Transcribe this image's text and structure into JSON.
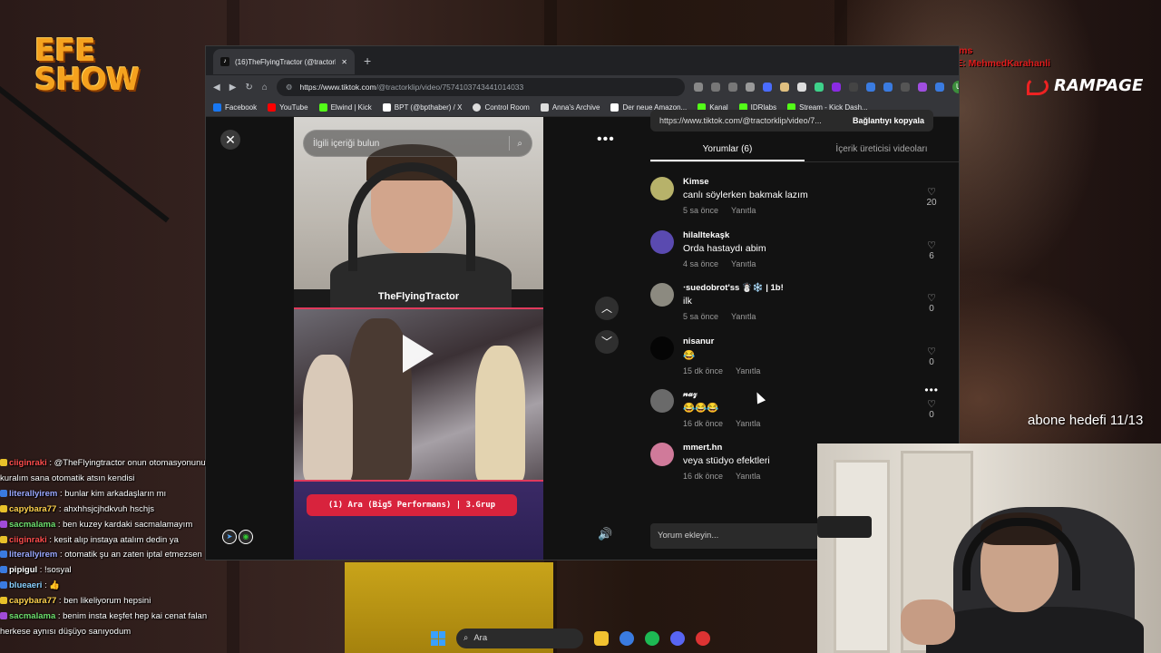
{
  "overlay": {
    "logo_top": "EFE",
    "logo_bottom": "SHOW",
    "sponsor": "RAMPAGE",
    "last_sub_label": "SON ABONE: remynms",
    "last_gift_label": "SON ABONE HEDİYE: MehmedKarahanli",
    "sub_goal": "abone hedefi 11/13"
  },
  "browser": {
    "tab_title": "(16)TheFlyingTractor (@tractorkl",
    "url_host": "https://www.tiktok.com",
    "url_path": "/@tractorklip/video/7574103743441014033",
    "bookmarks": [
      {
        "label": "Facebook",
        "color": "#1877f2"
      },
      {
        "label": "YouTube",
        "color": "#ff0000"
      },
      {
        "label": "Elwind | Kick",
        "color": "#53fc18"
      },
      {
        "label": "BPT (@bpthaber) / X",
        "color": "#ffffff"
      },
      {
        "label": "Control Room",
        "color": "#dddddd"
      },
      {
        "label": "Anna's Archive",
        "color": "#dddddd"
      },
      {
        "label": "Der neue Amazon...",
        "color": "#ffffff"
      },
      {
        "label": "Kanal",
        "color": "#53fc18"
      },
      {
        "label": "IDRlabs",
        "color": "#53fc18"
      },
      {
        "label": "Stream - Kick Dash...",
        "color": "#53fc18"
      }
    ]
  },
  "tiktok": {
    "search_placeholder": "İlgili içeriği bulun",
    "creator_name": "TheFlyingTractor",
    "video_banner": "(1) Ara (Big5 Performans) | 3.Grup",
    "link_text": "https://www.tiktok.com/@tractorklip/video/7...",
    "copy_link_label": "Bağlantıyı kopyala",
    "tabs": [
      "Yorumlar (6)",
      "İçerik üreticisi videoları"
    ],
    "add_comment_placeholder": "Yorum ekleyin...",
    "comments": [
      {
        "user": "Kimse",
        "text": "canlı söylerken bakmak lazım",
        "time": "5 sa önce",
        "reply": "Yanıtla",
        "likes": "20",
        "avatar": "#b7b26a"
      },
      {
        "user": "hilalltekaşk",
        "text": "Orda hastaydı abim",
        "time": "4 sa önce",
        "reply": "Yanıtla",
        "likes": "6",
        "avatar": "#5a4ab0"
      },
      {
        "user": "⋅suedobrot'ss ☃️❄️ | 1b!",
        "text": "ilk",
        "time": "5 sa önce",
        "reply": "Yanıtla",
        "likes": "0",
        "avatar": "#8c8a80"
      },
      {
        "user": "nisanur",
        "text": "😂",
        "time": "15 dk önce",
        "reply": "Yanıtla",
        "likes": "0",
        "avatar": "#050505"
      },
      {
        "user": "𝓃𝒶𝓏",
        "text": "😂😂😂",
        "time": "16 dk önce",
        "reply": "Yanıtla",
        "likes": "0",
        "avatar": "#6a6a6a"
      },
      {
        "user": "mmert.hn",
        "text": "veya stüdyo efektleri",
        "time": "16 dk önce",
        "reply": "Yanıtla",
        "likes": "",
        "avatar": "#d07a9a"
      }
    ]
  },
  "chat": [
    {
      "user": "ciiginraki",
      "color": "#ff4d4d",
      "badge": "#e8c12a",
      "text": " : @TheFlyingtractor onun otomasyonunu"
    },
    {
      "user": "",
      "color": "#ffffff",
      "badge": "",
      "text": "kuralım sana otomatik atsın kendisi"
    },
    {
      "user": "literallyirem",
      "color": "#9aa8ff",
      "badge": "#3a7be0",
      "text": " : bunlar kim arkadaşların mı"
    },
    {
      "user": "capybara77",
      "color": "#ffd24d",
      "badge": "#e8c12a",
      "text": " : ahxhhsjcjhdkvuh hschjs"
    },
    {
      "user": "sacmalama",
      "color": "#6ee06e",
      "badge": "#a14bd8",
      "text": " : ben kuzey kardaki sacmalamayım"
    },
    {
      "user": "ciiginraki",
      "color": "#ff4d4d",
      "badge": "#e8c12a",
      "text": " : kesit alıp instaya atalım dedin ya"
    },
    {
      "user": "literallyirem",
      "color": "#9aa8ff",
      "badge": "#3a7be0",
      "text": " : otomatik şu an zaten iptal etmezsen"
    },
    {
      "user": "pipigul",
      "color": "#ffffff",
      "badge": "#3a7be0",
      "text": " : !sosyal"
    },
    {
      "user": "blueaeri",
      "color": "#8ad0ff",
      "badge": "#3a7be0",
      "text": " : 👍"
    },
    {
      "user": "capybara77",
      "color": "#ffd24d",
      "badge": "#e8c12a",
      "text": " : ben likeliyorum hepsini"
    },
    {
      "user": "sacmalama",
      "color": "#6ee06e",
      "badge": "#a14bd8",
      "text": " : benim insta keşfet hep kai cenat falan"
    },
    {
      "user": "",
      "color": "#ffffff",
      "badge": "",
      "text": "herkese aynısı düşüyo sanıyodum"
    }
  ],
  "taskbar": {
    "search_label": "Ara"
  }
}
